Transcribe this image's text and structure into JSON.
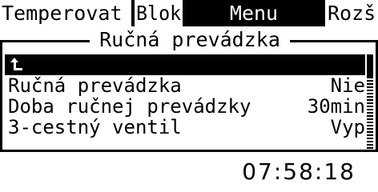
{
  "tabs": [
    {
      "label": "Temperovat",
      "active": false
    },
    {
      "label": "Blok",
      "active": false
    },
    {
      "label": "Menu",
      "active": true
    },
    {
      "label": "Rozš",
      "active": false
    }
  ],
  "panel": {
    "title": "Ručná prevádzka",
    "back_icon": "back-arrow-icon",
    "rows": [
      {
        "label": "Ručná prevádzka",
        "value": "Nie"
      },
      {
        "label": "Doba ručnej prevádzky",
        "value": "30min"
      },
      {
        "label": "3-cestný ventil",
        "value": "Vyp"
      }
    ]
  },
  "clock": {
    "time": "07:58:18"
  },
  "colors": {
    "foreground": "#000000",
    "background": "#ffffff"
  }
}
